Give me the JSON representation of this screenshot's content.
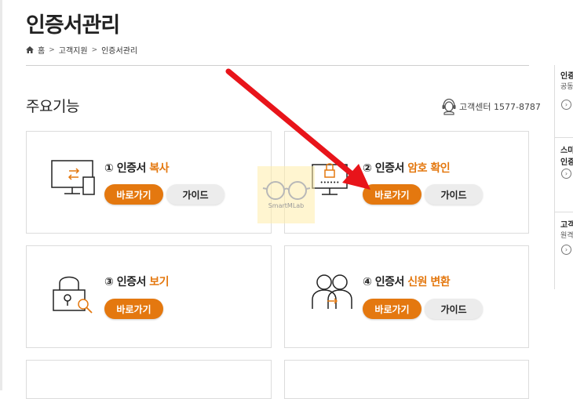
{
  "page": {
    "title": "인증서관리"
  },
  "breadcrumb": {
    "home": "홈",
    "level1": "고객지원",
    "level2": "인증서관리"
  },
  "section": {
    "title": "주요기능"
  },
  "contact": {
    "label": "고객센터 1577-8787"
  },
  "cards": [
    {
      "title_prefix": "① 인증서 ",
      "title_accent": "복사",
      "primary": "바로가기",
      "secondary": "가이드",
      "icon": "monitor-transfer-icon"
    },
    {
      "title_prefix": "② 인증서 ",
      "title_accent": "암호 확인",
      "primary": "바로가기",
      "secondary": "가이드",
      "icon": "monitor-lock-icon"
    },
    {
      "title_prefix": "③ 인증서 ",
      "title_accent": "보기",
      "primary": "바로가기",
      "icon": "lock-magnifier-icon"
    },
    {
      "title_prefix": "④ 인증서 ",
      "title_accent": "신원 변환",
      "primary": "바로가기",
      "secondary": "가이드",
      "icon": "two-people-icon"
    }
  ],
  "watermark": {
    "text": "SmartMLab"
  },
  "right_panel": {
    "items": [
      {
        "title": "인증",
        "sub": "공동"
      },
      {
        "title": "스마",
        "sub": "인증"
      },
      {
        "title": "고객",
        "sub": "원격"
      }
    ]
  },
  "colors": {
    "accent": "#e4780f",
    "arrow": "#e8141a"
  }
}
